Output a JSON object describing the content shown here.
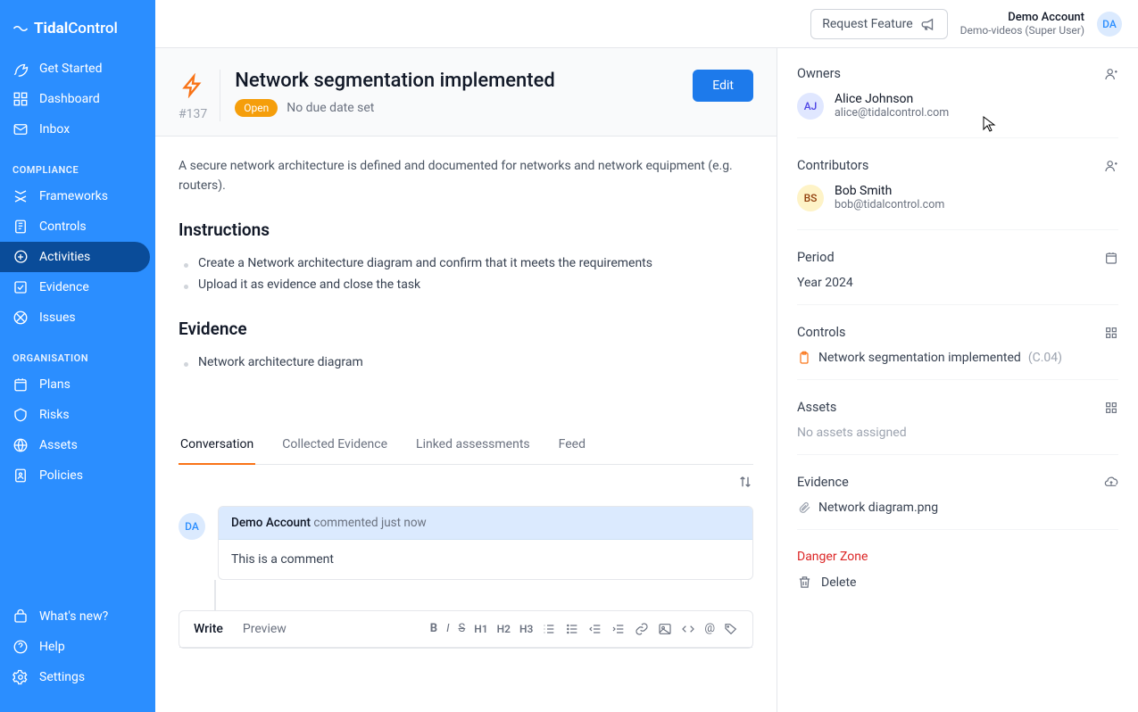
{
  "brand": {
    "bold": "Tidal",
    "rest": "Control"
  },
  "nav": {
    "top": [
      {
        "label": "Get Started"
      },
      {
        "label": "Dashboard"
      },
      {
        "label": "Inbox"
      }
    ],
    "compliance_heading": "COMPLIANCE",
    "compliance": [
      {
        "label": "Frameworks"
      },
      {
        "label": "Controls"
      },
      {
        "label": "Activities",
        "active": true
      },
      {
        "label": "Evidence"
      },
      {
        "label": "Issues"
      }
    ],
    "organisation_heading": "ORGANISATION",
    "organisation": [
      {
        "label": "Plans"
      },
      {
        "label": "Risks"
      },
      {
        "label": "Assets"
      },
      {
        "label": "Policies"
      }
    ],
    "bottom": [
      {
        "label": "What's new?"
      },
      {
        "label": "Help"
      },
      {
        "label": "Settings"
      }
    ]
  },
  "topbar": {
    "request": "Request Feature",
    "account_name": "Demo Account",
    "account_sub": "Demo-videos (Super User)",
    "avatar": "DA"
  },
  "activity": {
    "title": "Network segmentation implemented",
    "id": "#137",
    "status": "Open",
    "due": "No due date set",
    "edit": "Edit",
    "description": "A secure network architecture is defined and documented for networks and network equipment (e.g. routers).",
    "instructions_heading": "Instructions",
    "instructions": [
      "Create a Network architecture diagram and confirm that it meets the requirements",
      "Upload it as evidence and close the task"
    ],
    "evidence_heading": "Evidence",
    "evidence_items": [
      "Network architecture diagram"
    ]
  },
  "tabs": [
    "Conversation",
    "Collected Evidence",
    "Linked assessments",
    "Feed"
  ],
  "comment": {
    "avatar": "DA",
    "author": "Demo Account",
    "suffix": " commented just now",
    "body": "This is a comment"
  },
  "editor": {
    "write": "Write",
    "preview": "Preview",
    "headings": [
      "H1",
      "H2",
      "H3"
    ]
  },
  "panel": {
    "owners_label": "Owners",
    "owner": {
      "initials": "AJ",
      "name": "Alice Johnson",
      "email": "alice@tidalcontrol.com"
    },
    "contributors_label": "Contributors",
    "contributor": {
      "initials": "BS",
      "name": "Bob Smith",
      "email": "bob@tidalcontrol.com"
    },
    "period_label": "Period",
    "period_value": "Year 2024",
    "controls_label": "Controls",
    "control_name": "Network segmentation implemented",
    "control_code": "(C.04)",
    "assets_label": "Assets",
    "assets_empty": "No assets assigned",
    "evidence_label": "Evidence",
    "evidence_file": "Network diagram.png",
    "danger_label": "Danger Zone",
    "delete_label": "Delete"
  }
}
